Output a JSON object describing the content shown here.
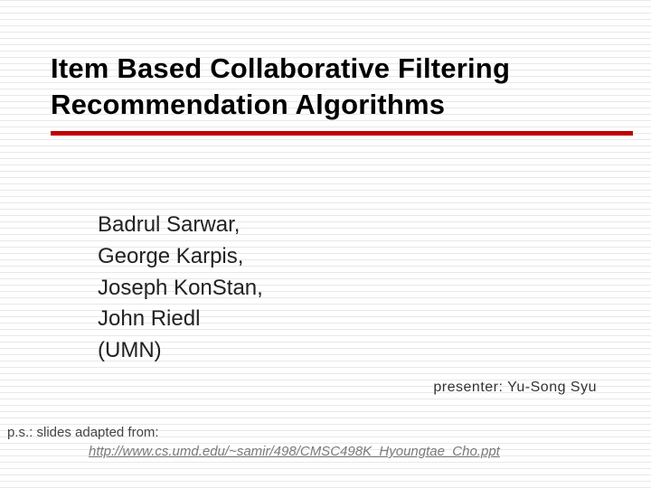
{
  "slide": {
    "title_line1": "Item Based Collaborative Filtering",
    "title_line2": "Recommendation Algorithms",
    "authors": [
      "Badrul Sarwar,",
      "George Karpis,",
      "Joseph KonStan,",
      "John Riedl",
      "(UMN)"
    ],
    "presenter_label": "presenter: Yu-Song Syu",
    "footnote_label": "p.s.: slides adapted from:",
    "footnote_link": "http://www.cs.umd.edu/~samir/498/CMSC498K_Hyoungtae_Cho.ppt"
  }
}
